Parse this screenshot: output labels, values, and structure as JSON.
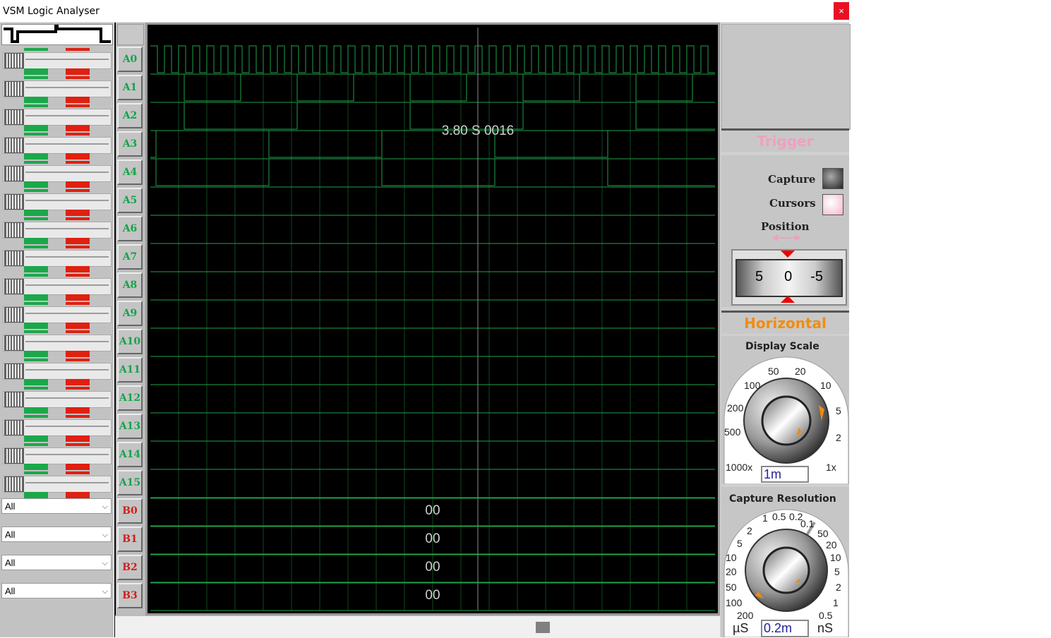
{
  "window": {
    "title": "VSM Logic Analyser",
    "close_glyph": "×"
  },
  "channels_a": [
    "A0",
    "A1",
    "A2",
    "A3",
    "A4",
    "A5",
    "A6",
    "A7",
    "A8",
    "A9",
    "A10",
    "A11",
    "A12",
    "A13",
    "A14",
    "A15"
  ],
  "channels_b": [
    "B0",
    "B1",
    "B2",
    "B3"
  ],
  "bus_values": [
    "00",
    "00",
    "00",
    "00"
  ],
  "filters": [
    "All",
    "All",
    "All",
    "All"
  ],
  "cursor_readout": "3.80 S 0016",
  "trigger": {
    "heading": "Trigger",
    "capture_label": "Capture",
    "cursors_label": "Cursors",
    "position_label": "Position",
    "position_ticks": [
      "5",
      "0",
      "-5"
    ]
  },
  "horizontal": {
    "heading": "Horizontal",
    "display_scale": {
      "label": "Display Scale",
      "ticks": [
        "50",
        "20",
        "100",
        "10",
        "200",
        "5",
        "500",
        "2",
        "1000x",
        "1x"
      ],
      "value": "1m"
    },
    "capture_resolution": {
      "label": "Capture Resolution",
      "ticks": [
        "1",
        "0.5",
        "0.2",
        "0.1",
        "2",
        "50",
        "5",
        "20",
        "10",
        "10",
        "20",
        "5",
        "50",
        "2",
        "100",
        "1",
        "200",
        "0.5"
      ],
      "unit_left": "µS",
      "unit_right": "nS",
      "value": "0.2m"
    }
  },
  "colors": {
    "trace": "#1ea24a",
    "grid": "#0e4a1e",
    "b_label": "#d0201a",
    "a_label": "#16a34a"
  }
}
